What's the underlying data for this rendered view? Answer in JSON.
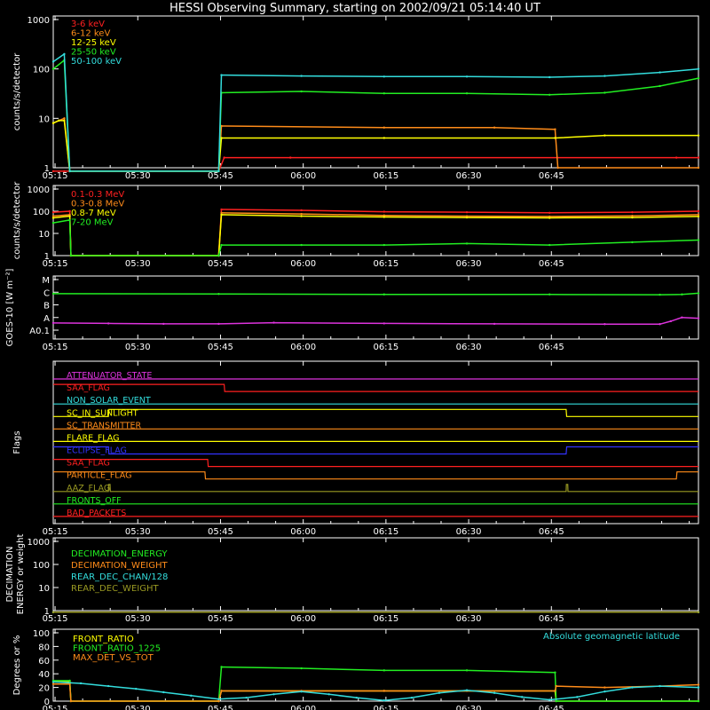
{
  "title": "HESSI Observing Summary, starting on 2002/09/21 05:14:40 UT",
  "time_axis": {
    "ticks": [
      "05:15",
      "05:30",
      "05:45",
      "06:00",
      "06:15",
      "06:30",
      "06:45"
    ],
    "range_minutes": [
      0,
      117
    ]
  },
  "colors": {
    "background": "#000000",
    "axes": "#ffffff",
    "red": "#ff2020",
    "orange": "#ff8c1a",
    "yellow": "#ffff00",
    "green": "#22ee22",
    "cyan": "#33dddd",
    "magenta": "#dd33dd",
    "blue": "#3333ff",
    "olive": "#999922"
  },
  "chart_data": [
    {
      "type": "line",
      "ylabel": "counts/s/detector",
      "yscale": "log",
      "ylim": [
        1,
        1000
      ],
      "yticks": [
        "1",
        "10",
        "100",
        "1000"
      ],
      "series": [
        {
          "name": "3-6 keV",
          "color": "#ff2020",
          "x": [
            0,
            2,
            3,
            30,
            31,
            43,
            113,
            117
          ],
          "y": [
            0,
            0,
            0,
            0,
            1.6,
            1.6,
            1.6,
            1.6
          ]
        },
        {
          "name": "6-12 keV",
          "color": "#ff8c1a",
          "x": [
            0,
            1,
            2,
            3,
            30,
            30.5,
            60,
            80,
            91,
            91.5,
            117
          ],
          "y": [
            8,
            9,
            10,
            0,
            0,
            7,
            6.5,
            6.5,
            6,
            1,
            1
          ]
        },
        {
          "name": "12-25 keV",
          "color": "#ffff00",
          "x": [
            0,
            1,
            2,
            3,
            30,
            30.5,
            60,
            91,
            100,
            117
          ],
          "y": [
            8,
            9,
            9,
            0,
            0,
            4,
            4,
            4,
            4.5,
            4.5
          ]
        },
        {
          "name": "25-50 keV",
          "color": "#22ee22",
          "x": [
            0,
            2,
            3,
            30,
            30.5,
            45,
            60,
            75,
            90,
            100,
            110,
            117
          ],
          "y": [
            100,
            150,
            0,
            0,
            33,
            35,
            32,
            32,
            30,
            33,
            45,
            65
          ]
        },
        {
          "name": "50-100 keV",
          "color": "#33dddd",
          "x": [
            0,
            2,
            3,
            30,
            30.5,
            45,
            60,
            75,
            90,
            100,
            110,
            117
          ],
          "y": [
            140,
            200,
            0,
            0,
            75,
            72,
            70,
            70,
            68,
            72,
            85,
            100
          ]
        }
      ]
    },
    {
      "type": "line",
      "ylabel": "counts/s/detector",
      "yscale": "log",
      "ylim": [
        1,
        1000
      ],
      "yticks": [
        "1",
        "10",
        "100",
        "1000"
      ],
      "series": [
        {
          "name": "0.1-0.3 MeV",
          "color": "#ff2020",
          "x": [
            0,
            3,
            3.2,
            30,
            30.5,
            45,
            60,
            75,
            90,
            105,
            117
          ],
          "y": [
            90,
            100,
            1,
            1,
            120,
            110,
            95,
            90,
            85,
            90,
            100
          ]
        },
        {
          "name": "0.3-0.8 MeV",
          "color": "#ff8c1a",
          "x": [
            0,
            3,
            3.2,
            30,
            30.5,
            45,
            60,
            75,
            90,
            105,
            117
          ],
          "y": [
            60,
            70,
            1,
            1,
            85,
            75,
            65,
            60,
            58,
            62,
            70
          ]
        },
        {
          "name": "0.8-7 MeV",
          "color": "#ffff00",
          "x": [
            0,
            3,
            3.2,
            30,
            30.5,
            45,
            60,
            75,
            90,
            105,
            117
          ],
          "y": [
            50,
            60,
            1,
            1,
            70,
            60,
            55,
            52,
            50,
            52,
            58
          ]
        },
        {
          "name": "7-20 MeV",
          "color": "#22ee22",
          "x": [
            0,
            3,
            3.2,
            30,
            30.5,
            45,
            60,
            75,
            90,
            105,
            117
          ],
          "y": [
            30,
            40,
            1,
            1,
            3,
            3,
            3,
            3.5,
            3,
            4,
            5
          ]
        }
      ]
    },
    {
      "type": "line",
      "ylabel": "GOES-10 [W m⁻²]",
      "ylim": [
        0,
        4
      ],
      "yticks": [
        "A0.1",
        "A",
        "B",
        "C",
        "M"
      ],
      "series": [
        {
          "color": "#22ee22",
          "x": [
            0,
            30,
            60,
            90,
            110,
            114,
            117
          ],
          "y": [
            3.05,
            3.03,
            3.0,
            3.0,
            2.98,
            3.0,
            3.08
          ]
        },
        {
          "color": "#dd33dd",
          "x": [
            0,
            10,
            20,
            30,
            40,
            60,
            80,
            100,
            110,
            112,
            114,
            117
          ],
          "y": [
            1.08,
            1.05,
            1.02,
            1.02,
            1.1,
            1.05,
            1.02,
            1.0,
            1.0,
            1.2,
            1.45,
            1.4
          ]
        }
      ]
    },
    {
      "type": "line",
      "ylabel": "Flags",
      "series": [
        {
          "name": "ATTENUATOR_STATE",
          "color": "#dd33dd",
          "x": [
            0,
            117
          ],
          "y": [
            0,
            0
          ]
        },
        {
          "name": "SAA_FLAG",
          "color": "#ff2020",
          "x": [
            0,
            31,
            31.1,
            117
          ],
          "y": [
            1,
            1,
            0,
            0
          ]
        },
        {
          "name": "NON_SOLAR_EVENT",
          "color": "#33dddd",
          "x": [
            0,
            117
          ],
          "y": [
            0,
            0
          ]
        },
        {
          "name": "SC_IN_SUNLIGHT",
          "color": "#ffff00",
          "x": [
            0,
            10,
            10.1,
            93,
            93.1,
            117
          ],
          "y": [
            0,
            0,
            1,
            1,
            0,
            0
          ]
        },
        {
          "name": "SC_TRANSMITTER",
          "color": "#ff8c1a",
          "x": [
            0,
            117
          ],
          "y": [
            0,
            0
          ]
        },
        {
          "name": "FLARE_FLAG",
          "color": "#ffff00",
          "x": [
            0,
            117
          ],
          "y": [
            0,
            0
          ]
        },
        {
          "name": "ECLIPSE_FLAG",
          "color": "#3333ff",
          "x": [
            0,
            10,
            10.1,
            93,
            93.1,
            117
          ],
          "y": [
            1,
            1,
            0,
            0,
            1,
            1
          ]
        },
        {
          "name": "SAA_FLAG",
          "color": "#ff2020",
          "x": [
            0,
            28,
            28.1,
            117
          ],
          "y": [
            1,
            1,
            0,
            0
          ]
        },
        {
          "name": "PARTICLE_FLAG",
          "color": "#ff8c1a",
          "x": [
            0,
            27.5,
            27.6,
            113,
            113.1,
            117
          ],
          "y": [
            1,
            1,
            0,
            0,
            1,
            1
          ]
        },
        {
          "name": "AAZ_FLAG",
          "color": "#999922",
          "x": [
            0,
            10,
            10.05,
            10.3,
            10.35,
            93,
            93.05,
            93.3,
            93.35,
            117
          ],
          "y": [
            0,
            0,
            1,
            1,
            0,
            0,
            1,
            1,
            0,
            0
          ]
        },
        {
          "name": "FRONTS_OFF",
          "color": "#22ee22",
          "x": [
            0,
            117
          ],
          "y": [
            0,
            0
          ]
        },
        {
          "name": "BAD_PACKETS",
          "color": "#ff2020",
          "x": [
            0,
            117
          ],
          "y": [
            0,
            0
          ]
        }
      ]
    },
    {
      "type": "line",
      "ylabel": "DECIMATION ENERGY or weight",
      "yscale": "log",
      "ylim": [
        1,
        1000
      ],
      "yticks": [
        "1",
        "10",
        "100",
        "1000"
      ],
      "series": [
        {
          "name": "DECIMATION_ENERGY",
          "color": "#22ee22",
          "x": [
            0,
            117
          ],
          "y": [
            0,
            0
          ]
        },
        {
          "name": "DECIMATION_WEIGHT",
          "color": "#ff8c1a",
          "x": [
            0,
            117
          ],
          "y": [
            0,
            0
          ]
        },
        {
          "name": "REAR_DEC_CHAN/128",
          "color": "#33dddd",
          "x": [
            0,
            117
          ],
          "y": [
            0,
            0
          ]
        },
        {
          "name": "REAR_DEC_WEIGHT",
          "color": "#999922",
          "x": [
            0,
            117
          ],
          "y": [
            0,
            0
          ]
        }
      ]
    },
    {
      "type": "line",
      "ylabel": "Degrees or %",
      "ylim": [
        0,
        100
      ],
      "yticks": [
        "0",
        "20",
        "40",
        "60",
        "80",
        "100"
      ],
      "annotation": "Absolute geomagnetic latitude",
      "series": [
        {
          "name": "FRONT_RATIO",
          "color": "#ffff00",
          "x": [
            0,
            3,
            3.2,
            30,
            30.5,
            60,
            91,
            91.2,
            117
          ],
          "y": [
            28,
            28,
            0,
            0,
            15,
            15,
            15,
            0,
            0
          ]
        },
        {
          "name": "FRONT_RATIO_1225",
          "color": "#22ee22",
          "x": [
            0,
            3,
            3.2,
            30,
            30.5,
            45,
            60,
            75,
            91,
            91.2,
            117
          ],
          "y": [
            30,
            30,
            0,
            0,
            50,
            48,
            45,
            45,
            42,
            0,
            0
          ]
        },
        {
          "name": "MAX_DET_VS_TOT",
          "color": "#ff8c1a",
          "x": [
            0,
            3,
            3.2,
            30,
            30.5,
            45,
            60,
            75,
            91,
            91.2,
            100,
            110,
            117
          ],
          "y": [
            25,
            25,
            0,
            0,
            15,
            15,
            15,
            15,
            15,
            22,
            20,
            22,
            24
          ]
        },
        {
          "name": "Absolute geomagnetic latitude",
          "color": "#33dddd",
          "x": [
            0,
            5,
            10,
            15,
            20,
            25,
            30,
            35,
            40,
            45,
            50,
            55,
            60,
            65,
            70,
            75,
            80,
            85,
            90,
            95,
            100,
            105,
            110,
            117
          ],
          "y": [
            28,
            26,
            22,
            18,
            13,
            8,
            3,
            5,
            10,
            14,
            10,
            5,
            1,
            5,
            12,
            16,
            12,
            6,
            2,
            6,
            14,
            20,
            22,
            20
          ]
        }
      ]
    }
  ]
}
